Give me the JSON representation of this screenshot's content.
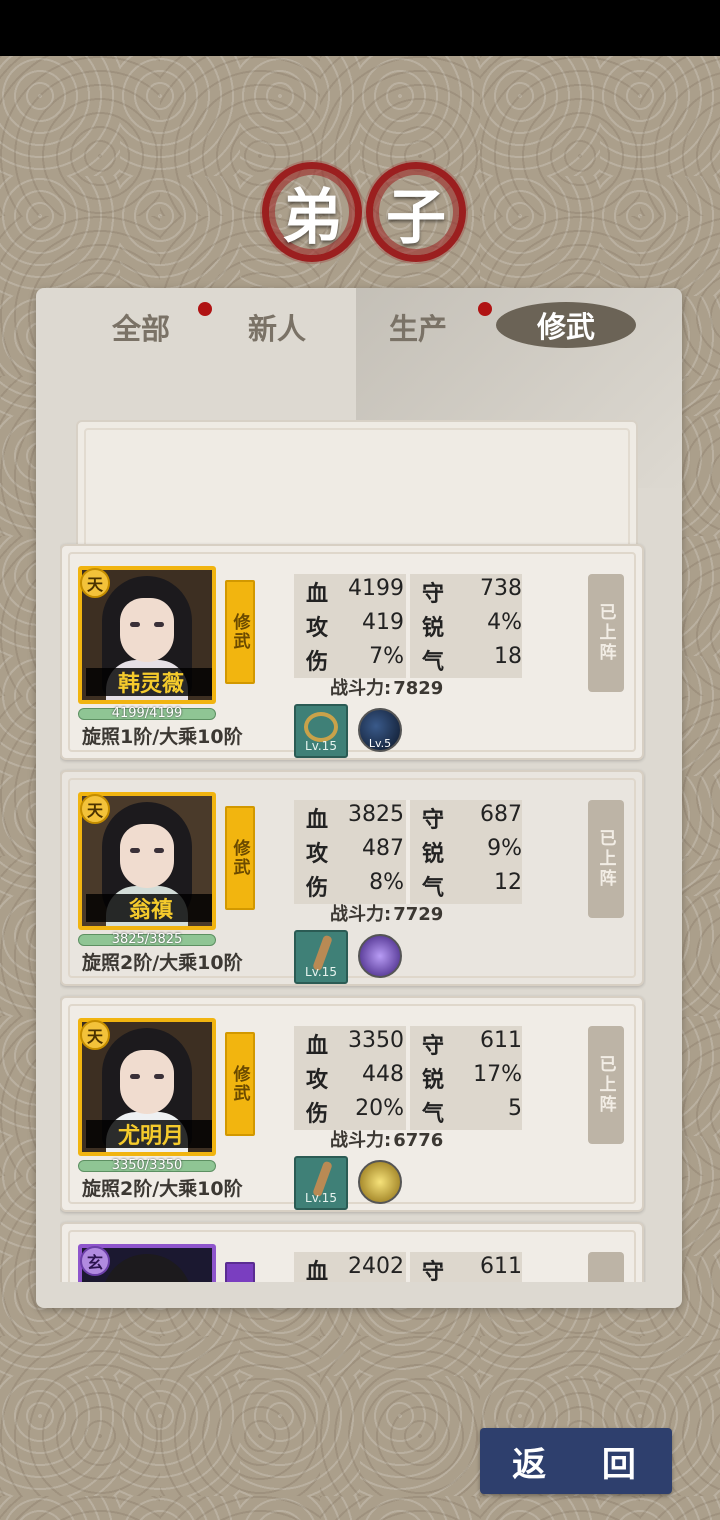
{
  "title": {
    "char1": "弟",
    "char2": "子"
  },
  "tabs": [
    {
      "label": "全部",
      "has_dot": true
    },
    {
      "label": "新人",
      "has_dot": false
    },
    {
      "label": "生产",
      "has_dot": true
    },
    {
      "label": "修武",
      "has_dot": false,
      "active": true
    }
  ],
  "labels": {
    "hp": "血",
    "def": "守",
    "atk": "攻",
    "crit": "锐",
    "dmg": "伤",
    "qi": "气",
    "power": "战斗力:",
    "deployed": "已上阵",
    "back": "返 回"
  },
  "disciples": [
    {
      "grade": "天",
      "name": "韩灵薇",
      "hp_text": "4199/4199",
      "realm": "旋照1阶/大乘10阶",
      "role": "修武",
      "hp": "4199",
      "def": "738",
      "atk": "419",
      "crit": "4%",
      "dmg": "7%",
      "qi": "18",
      "power": "7829",
      "item_level": "Lv.15",
      "skill_level": "Lv.5",
      "status": "已上阵"
    },
    {
      "grade": "天",
      "name": "翁禛",
      "hp_text": "3825/3825",
      "realm": "旋照2阶/大乘10阶",
      "role": "修武",
      "hp": "3825",
      "def": "687",
      "atk": "487",
      "crit": "9%",
      "dmg": "8%",
      "qi": "12",
      "power": "7729",
      "item_level": "Lv.15",
      "skill_level": "",
      "status": "已上阵"
    },
    {
      "grade": "天",
      "name": "尤明月",
      "hp_text": "3350/3350",
      "realm": "旋照2阶/大乘10阶",
      "role": "修武",
      "hp": "3350",
      "def": "611",
      "atk": "448",
      "crit": "17%",
      "dmg": "20%",
      "qi": "5",
      "power": "6776",
      "item_level": "Lv.15",
      "skill_level": "",
      "status": "已上阵"
    },
    {
      "grade": "玄",
      "hp": "2402",
      "def": "611"
    }
  ],
  "colors": {
    "seal_red": "#9b1f1f",
    "gold_frame": "#f1b410",
    "purple_frame": "#8e55cc",
    "back_button": "#2e3f6d",
    "tab_dot": "#b01313"
  }
}
